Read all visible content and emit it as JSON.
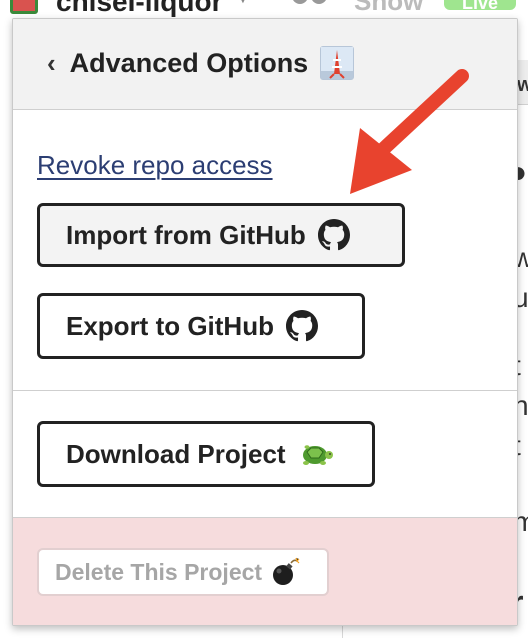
{
  "background": {
    "project_name": "chiseI-liquor",
    "show_label": "Show",
    "live_label": "Live",
    "colors": {
      "live_badge": "#9fe58f"
    }
  },
  "popover": {
    "title": "Advanced Options",
    "title_icon": "tokyo-tower-emoji",
    "back_icon": "chevron-left-icon",
    "revoke_link": "Revoke repo access",
    "import_button": "Import from GitHub",
    "export_button": "Export to GitHub",
    "github_icon": "github-octocat-icon",
    "download_button": "Download Project",
    "download_icon": "turtle-emoji",
    "delete_button": "Delete This Project",
    "delete_icon": "bomb-emoji",
    "delete_enabled": false
  },
  "annotation": {
    "type": "red-arrow",
    "points_to": "import_button",
    "color": "#e8432e"
  },
  "colors": {
    "header_bg": "#f2f2f2",
    "danger_section_bg": "#f6dcdd",
    "link": "#2c3e73",
    "button_border": "#222222"
  }
}
